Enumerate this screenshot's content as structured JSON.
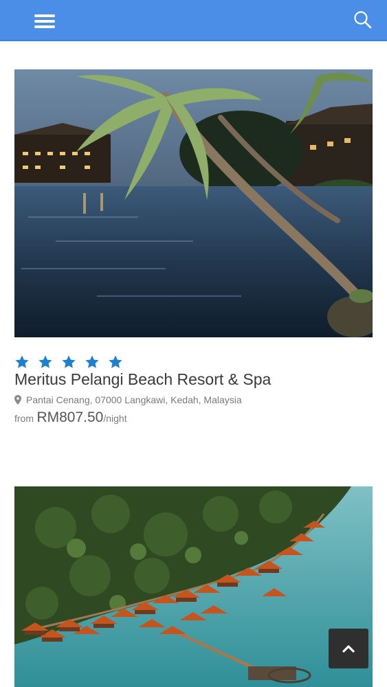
{
  "header": {
    "menu_icon": "hamburger-menu-icon",
    "search_icon": "search-icon",
    "bar_color": "#4a8ee8"
  },
  "hotels": [
    {
      "image": "resort-lagoon-palm-trees-photo",
      "stars": 5,
      "star_color": "#1f7fd1",
      "name": "Meritus Pelangi Beach Resort & Spa",
      "location_icon": "map-pin-icon",
      "location": "Pantai Cenang, 07000 Langkawi, Kedah, Malaysia",
      "price_prefix": "from",
      "price": "RM807.50",
      "price_unit": "/night"
    },
    {
      "image": "overwater-chalets-aerial-photo"
    }
  ],
  "back_to_top_icon": "chevron-up-icon"
}
